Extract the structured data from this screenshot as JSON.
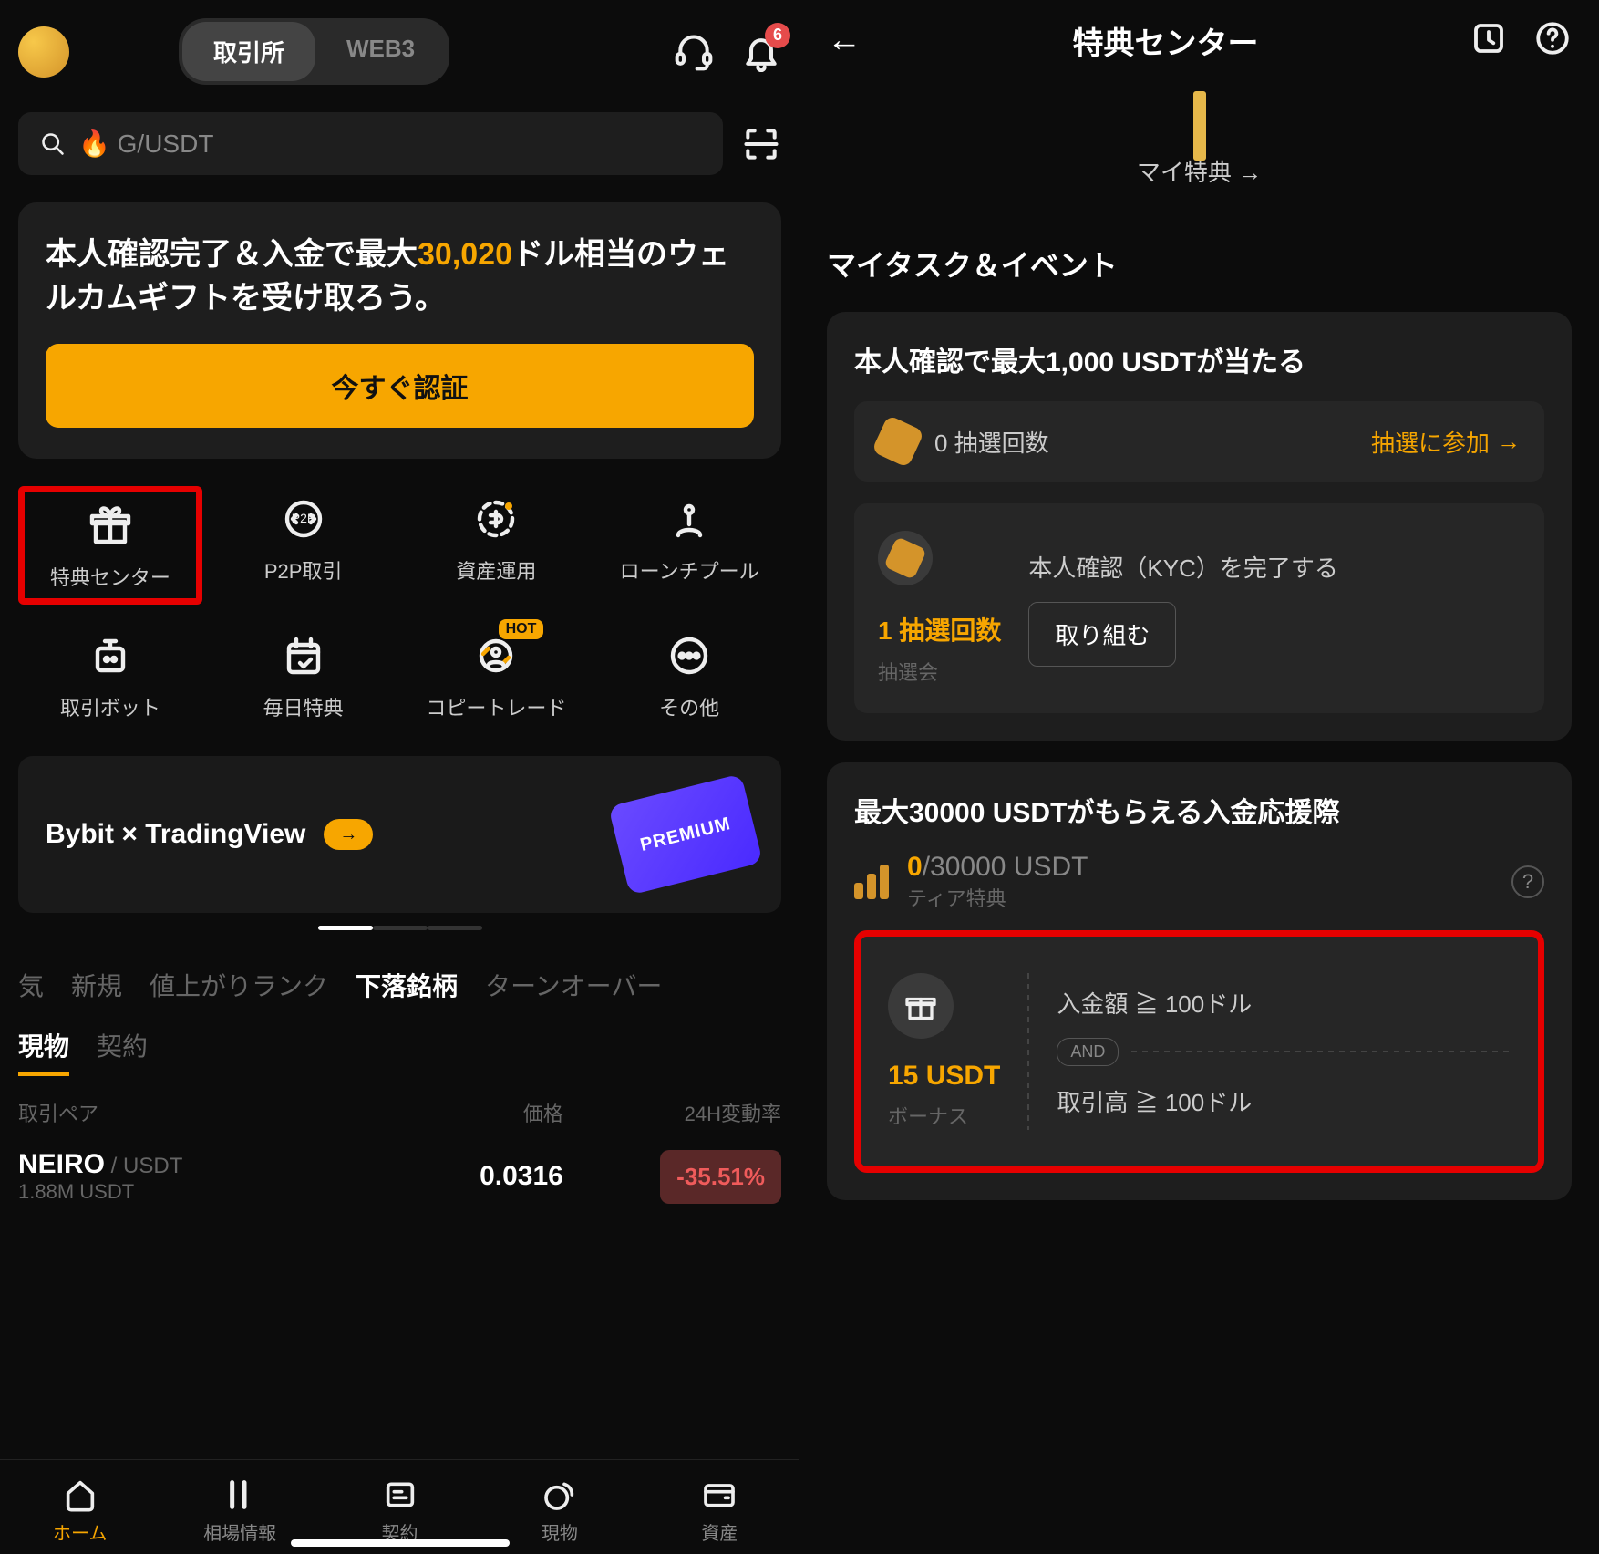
{
  "left": {
    "tabs": {
      "exchange": "取引所",
      "web3": "WEB3"
    },
    "notif_count": "6",
    "search_placeholder": "🔥 G/USDT",
    "banner_pre": "本人確認完了＆入金で最大",
    "banner_amount": "30,020",
    "banner_post": "ドル相当のウェルカムギフトを受け取ろう。",
    "banner_btn": "今すぐ認証",
    "grid": [
      {
        "label": "特典センター"
      },
      {
        "label": "P2P取引"
      },
      {
        "label": "資産運用"
      },
      {
        "label": "ローンチプール"
      },
      {
        "label": "取引ボット"
      },
      {
        "label": "毎日特典"
      },
      {
        "label": "コピートレード"
      },
      {
        "label": "その他"
      }
    ],
    "promo_label": "Bybit × TradingView",
    "promo_card_text": "PREMIUM",
    "mkt_tabs": [
      "気",
      "新規",
      "値上がりランク",
      "下落銘柄",
      "ターンオーバー"
    ],
    "sub_tabs": [
      "現物",
      "契約"
    ],
    "th_pair": "取引ペア",
    "th_price": "価格",
    "th_chg": "24H変動率",
    "ticker": {
      "sym": "NEIRO",
      "quote": " / USDT",
      "vol": "1.88M USDT",
      "price": "0.0316",
      "chg": "-35.51%"
    },
    "nav": [
      "ホーム",
      "相場情報",
      "契約",
      "現物",
      "資産"
    ]
  },
  "right": {
    "title": "特典センター",
    "my_rewards": "マイ特典",
    "section_tasks": "マイタスク＆イベント",
    "kyc_card_title": "本人確認で最大1,000 USDTが当たる",
    "lottery_count": "0 抽選回数",
    "lottery_action": "抽選に参加",
    "kyc_count": "1 抽選回数",
    "kyc_sub": "抽選会",
    "kyc_desc": "本人確認（KYC）を完了する",
    "kyc_btn": "取り組む",
    "deposit_card_title": "最大30000 USDTがもらえる入金応援際",
    "tier_current": "0",
    "tier_total": "/30000 USDT",
    "tier_sub": "ティア特典",
    "depo_amount": "15 USDT",
    "depo_sub": "ボーナス",
    "cond1": "入金額 ≧ 100ドル",
    "and_label": "AND",
    "cond2": "取引高 ≧ 100ドル"
  }
}
